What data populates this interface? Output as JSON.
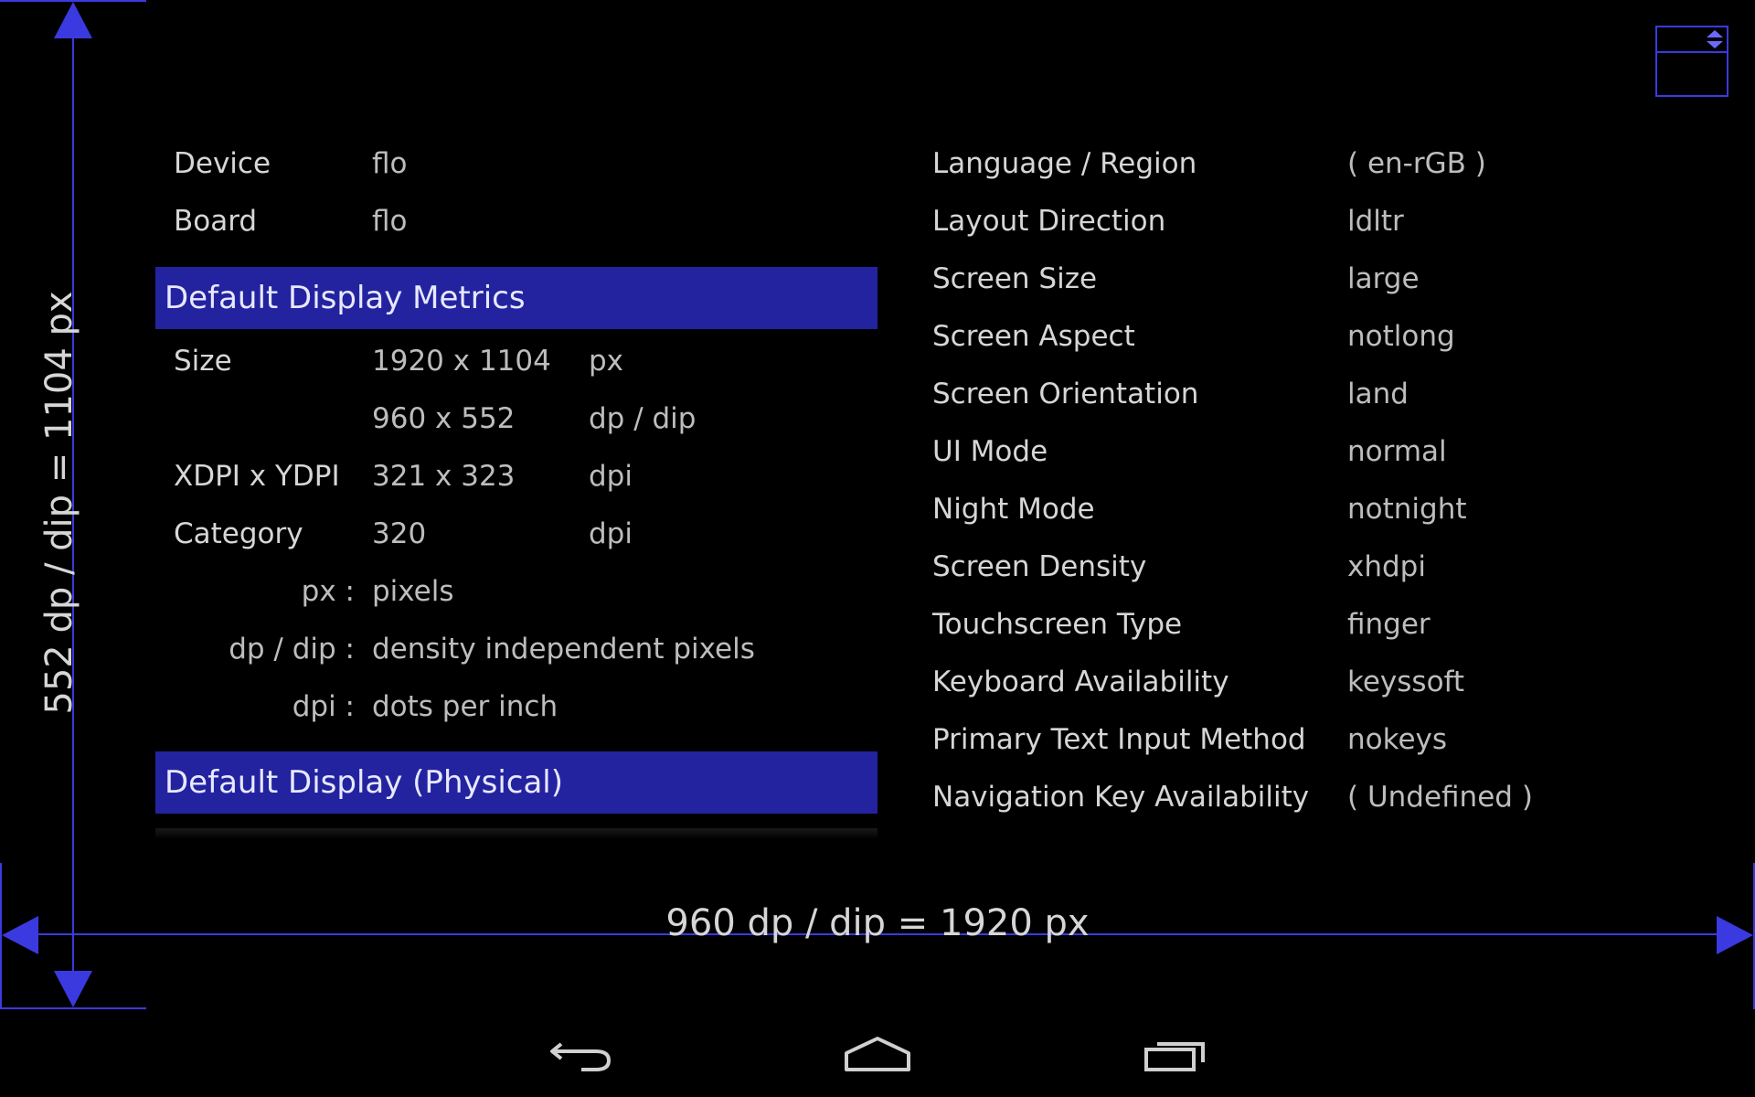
{
  "device_info": [
    {
      "label": "Device",
      "value": "flo"
    },
    {
      "label": "Board",
      "value": "flo"
    }
  ],
  "metrics_header": "Default Display Metrics",
  "metrics": {
    "size_label": "Size",
    "size_px": "1920 x 1104",
    "size_px_unit": "px",
    "size_dp": "960 x 552",
    "size_dp_unit": "dp / dip",
    "xdpi_label": "XDPI x YDPI",
    "xdpi_value": "321 x 323",
    "xdpi_unit": "dpi",
    "category_label": "Category",
    "category_value": "320",
    "category_unit": "dpi"
  },
  "legend": [
    {
      "key": "px :",
      "desc": "pixels"
    },
    {
      "key": "dp / dip :",
      "desc": "density independent pixels"
    },
    {
      "key": "dpi :",
      "desc": "dots per inch"
    }
  ],
  "physical_header": "Default Display (Physical)",
  "config": [
    {
      "label": "Language / Region",
      "value": "( en-rGB )"
    },
    {
      "label": "Layout Direction",
      "value": "ldltr"
    },
    {
      "label": "Screen Size",
      "value": "large"
    },
    {
      "label": "Screen Aspect",
      "value": "notlong"
    },
    {
      "label": "Screen Orientation",
      "value": "land"
    },
    {
      "label": "UI Mode",
      "value": "normal"
    },
    {
      "label": "Night Mode",
      "value": "notnight"
    },
    {
      "label": "Screen Density",
      "value": "xhdpi"
    },
    {
      "label": "Touchscreen Type",
      "value": "finger"
    },
    {
      "label": "Keyboard Availability",
      "value": "keyssoft"
    },
    {
      "label": "Primary Text Input Method",
      "value": "nokeys"
    },
    {
      "label": "Navigation Key Availability",
      "value": "( Undefined )"
    }
  ],
  "measure": {
    "vertical": "552 dp / dip   =   1104 px",
    "horizontal": "960 dp / dip    =    1920 px"
  },
  "colors": {
    "header_bg": "#2323a0",
    "measure_line": "#3a3ae0",
    "background": "#000000"
  },
  "nav_icons": [
    "back-icon",
    "home-icon",
    "recent-apps-icon"
  ]
}
